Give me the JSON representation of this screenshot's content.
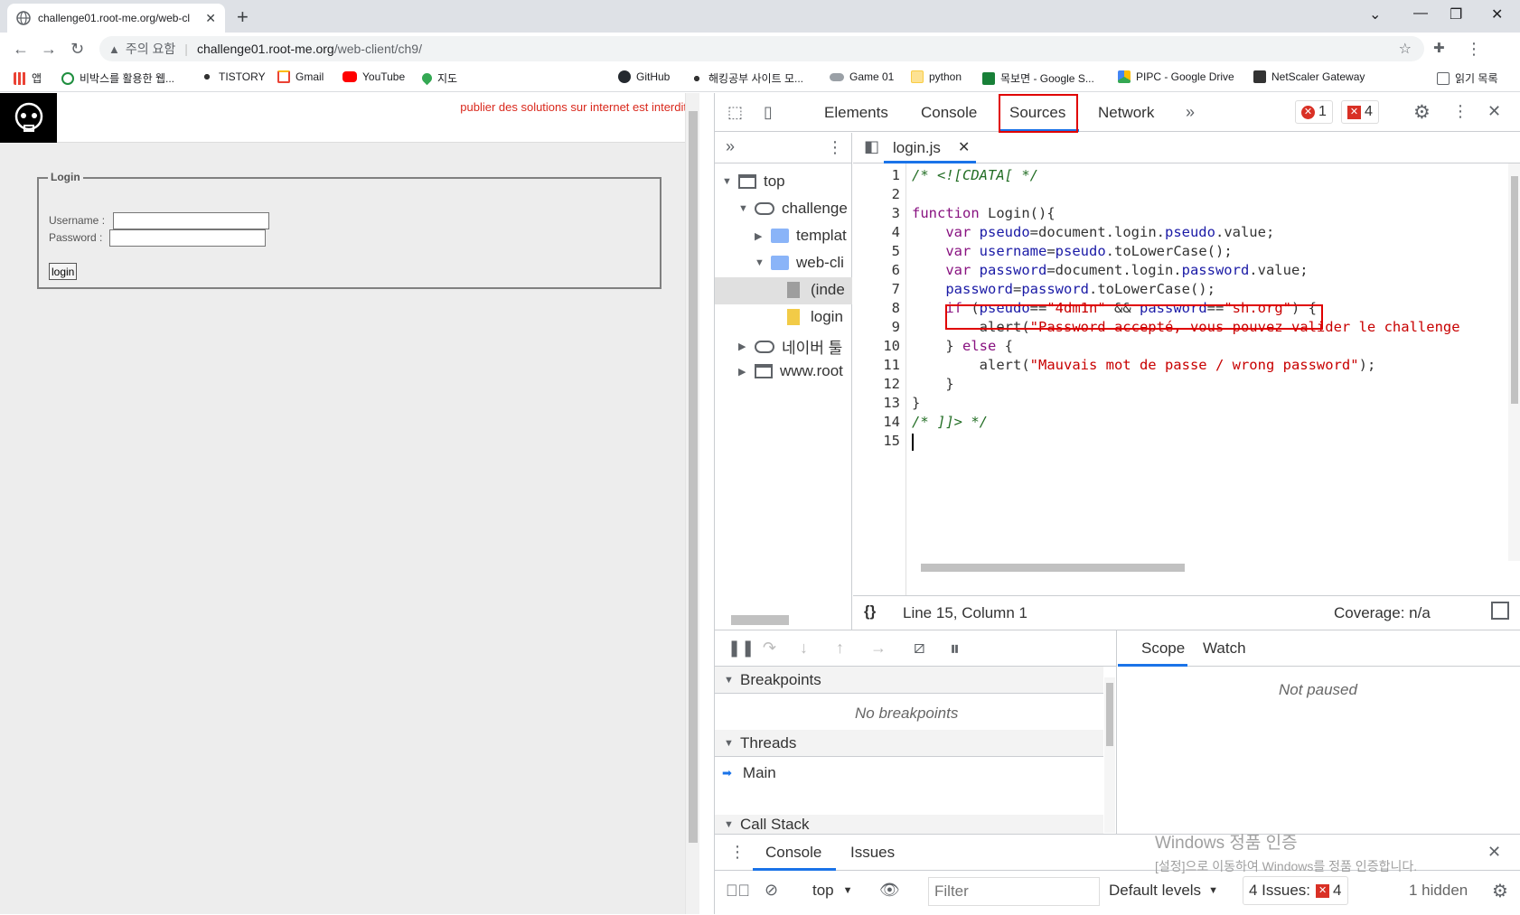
{
  "browser": {
    "tab_title": "challenge01.root-me.org/web-cl",
    "omnibox": {
      "warning": "주의 요함",
      "host": "challenge01.root-me.org",
      "path": "/web-client/ch9/"
    },
    "bookmarks": [
      {
        "label": "앱",
        "icon": "apps-icon"
      },
      {
        "label": "비박스를 활용한 웹...",
        "icon": "green-circle-icon"
      },
      {
        "label": "TISTORY",
        "icon": "tistory-icon"
      },
      {
        "label": "Gmail",
        "icon": "gmail-icon"
      },
      {
        "label": "YouTube",
        "icon": "youtube-icon"
      },
      {
        "label": "지도",
        "icon": "maps-pin-icon"
      },
      {
        "label": "GitHub",
        "icon": "github-icon"
      },
      {
        "label": "해킹공부 사이트 모...",
        "icon": "tistory-icon"
      },
      {
        "label": "Game 01",
        "icon": "gamepad-icon"
      },
      {
        "label": "python",
        "icon": "folder-icon"
      },
      {
        "label": "목보면 - Google S...",
        "icon": "sheets-icon"
      },
      {
        "label": "PIPC - Google Drive",
        "icon": "drive-icon"
      },
      {
        "label": "NetScaler Gateway",
        "icon": "netscaler-icon"
      },
      {
        "label": "읽기 목록",
        "icon": "reading-list-icon"
      }
    ]
  },
  "page": {
    "banner": "publier des solutions sur internet est interdit",
    "legend": "Login",
    "username_label": "Username :",
    "password_label": "Password :",
    "login_button": "login"
  },
  "devtools": {
    "tabs": [
      "Elements",
      "Console",
      "Sources",
      "Network"
    ],
    "active_tab": "Sources",
    "error_count": "1",
    "issue_count": "4",
    "tree": [
      {
        "label": "top"
      },
      {
        "label": "challenge"
      },
      {
        "label": "templat"
      },
      {
        "label": "web-cli"
      },
      {
        "label": "(inde"
      },
      {
        "label": "login"
      },
      {
        "label": "네이버 툴"
      },
      {
        "label": "www.root"
      }
    ],
    "file_tab": "login.js",
    "code_lines": [
      "/* <![CDATA[ */",
      "",
      "function Login(){",
      "    var pseudo=document.login.pseudo.value;",
      "    var username=pseudo.toLowerCase();",
      "    var password=document.login.password.value;",
      "    password=password.toLowerCase();",
      "    if (pseudo==\"4dm1n\" && password==\"sh.org\") {",
      "        alert(\"Password accepté, vous pouvez valider le challenge",
      "    } else {",
      "        alert(\"Mauvais mot de passe / wrong password\");",
      "    }",
      "}",
      "/* ]]> */",
      ""
    ],
    "status": {
      "position": "Line 15, Column 1",
      "coverage": "Coverage: n/a"
    },
    "debugger": {
      "breakpoints_title": "Breakpoints",
      "no_breakpoints": "No breakpoints",
      "threads_title": "Threads",
      "thread_main": "Main",
      "call_stack_title": "Call Stack",
      "scope_tab": "Scope",
      "watch_tab": "Watch",
      "not_paused": "Not paused"
    },
    "drawer": {
      "console_tab": "Console",
      "issues_tab": "Issues",
      "context": "top",
      "filter_placeholder": "Filter",
      "levels": "Default levels",
      "issues_label": "4 Issues:",
      "issues_count": "4",
      "hidden": "1 hidden"
    }
  },
  "watermark": {
    "line1": "Windows 정품 인증",
    "line2": "[설정]으로 이동하여 Windows를 정품 인증합니다."
  }
}
